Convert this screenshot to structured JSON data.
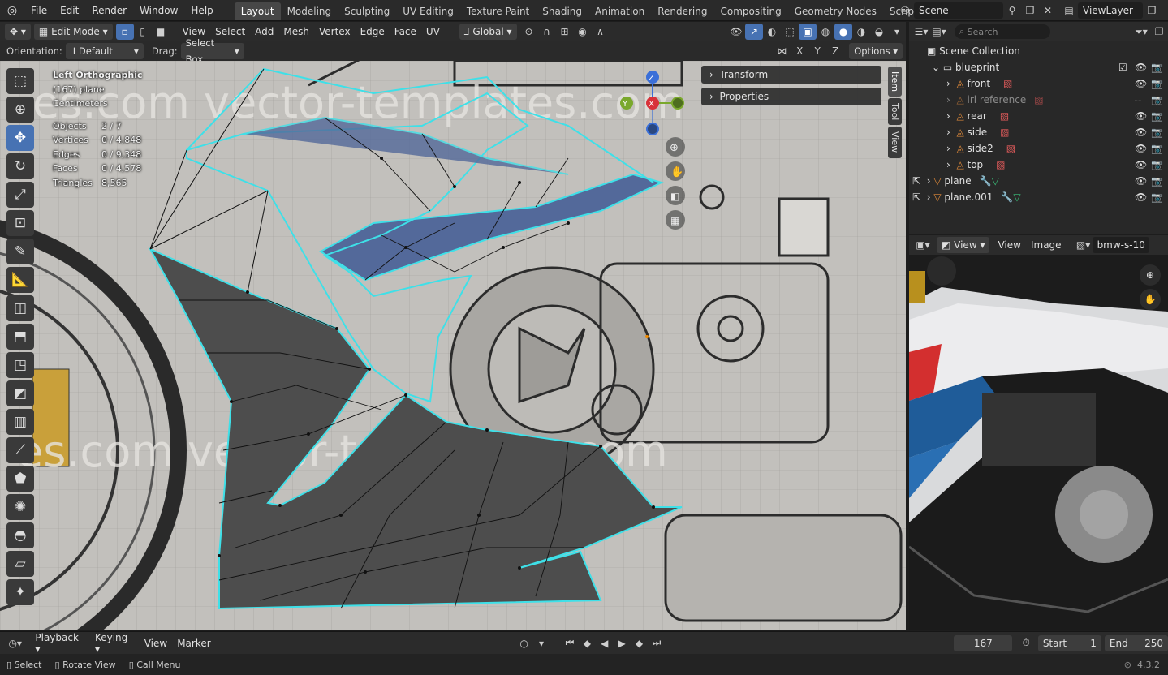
{
  "topbar": {
    "menus": [
      "File",
      "Edit",
      "Render",
      "Window",
      "Help"
    ],
    "workspaces": [
      "Layout",
      "Modeling",
      "Sculpting",
      "UV Editing",
      "Texture Paint",
      "Shading",
      "Animation",
      "Rendering",
      "Compositing",
      "Geometry Nodes",
      "Scripting"
    ],
    "active_workspace": "Layout",
    "scene": "Scene",
    "view_layer": "ViewLayer"
  },
  "viewport_header": {
    "mode": "Edit Mode",
    "menus": [
      "View",
      "Select",
      "Add",
      "Mesh",
      "Vertex",
      "Edge",
      "Face",
      "UV"
    ],
    "transform_orientation": "Global",
    "orientation_label": "Orientation:",
    "orientation_value": "Default",
    "drag_label": "Drag:",
    "drag_value": "Select Box",
    "axes": [
      "X",
      "Y",
      "Z"
    ],
    "options": "Options"
  },
  "overlay": {
    "view_name": "Left Orthographic",
    "object": "(167) plane",
    "units": "Centimeters",
    "stats": [
      {
        "label": "Objects",
        "value": "2 / 7"
      },
      {
        "label": "Vertices",
        "value": "0 / 4,848"
      },
      {
        "label": "Edges",
        "value": "0 / 9,348"
      },
      {
        "label": "Faces",
        "value": "0 / 4,578"
      },
      {
        "label": "Triangles",
        "value": "8,565"
      }
    ]
  },
  "gizmo": {
    "z": "Z",
    "y": "Y",
    "x": "X"
  },
  "npanel": {
    "transform": "Transform",
    "properties": "Properties",
    "tabs": [
      "Item",
      "Tool",
      "View"
    ]
  },
  "watermark": {
    "top": "es.com   vector-templates.com",
    "bottom": "es.com   vector-templates.com"
  },
  "outliner": {
    "search_placeholder": "Search",
    "root": "Scene Collection",
    "collection": "blueprint",
    "children": [
      "front",
      "irl reference",
      "rear",
      "side",
      "side2",
      "top"
    ],
    "objects": [
      "plane",
      "plane.001"
    ]
  },
  "image_editor": {
    "view_menu": "View",
    "menus": [
      "View",
      "Image"
    ],
    "image_name": "bmw-s-10"
  },
  "timeline": {
    "menus": [
      "Playback",
      "Keying",
      "View",
      "Marker"
    ],
    "current_frame": "167",
    "start_label": "Start",
    "start": "1",
    "end_label": "End",
    "end": "250"
  },
  "statusbar": {
    "select": "Select",
    "rotate": "Rotate View",
    "call_menu": "Call Menu",
    "version": "4.3.2"
  }
}
